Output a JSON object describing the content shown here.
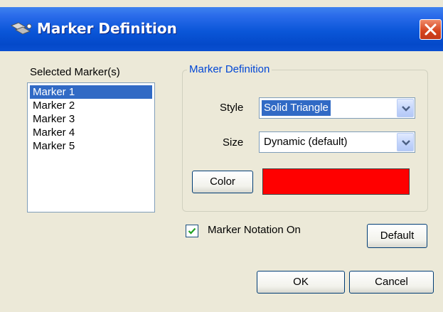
{
  "window": {
    "title": "Marker Definition",
    "icon": "markers-icon",
    "close_icon": "close-icon"
  },
  "markers": {
    "label": "Selected Marker(s)",
    "items": [
      "Marker 1",
      "Marker 2",
      "Marker 3",
      "Marker 4",
      "Marker 5"
    ],
    "selected": "Marker 1"
  },
  "definition": {
    "group_title": "Marker Definition",
    "style_label": "Style",
    "style_value": "Solid Triangle",
    "size_label": "Size",
    "size_value": "Dynamic (default)",
    "color_button": "Color",
    "color_value": "#ff0000"
  },
  "notation": {
    "label": "Marker Notation On",
    "checked": true
  },
  "buttons": {
    "default": "Default",
    "ok": "OK",
    "cancel": "Cancel"
  },
  "colors": {
    "title_bar": "#0a56d8",
    "selection": "#316ac5",
    "group_title": "#0046d5",
    "close_button": "#d4421c"
  }
}
